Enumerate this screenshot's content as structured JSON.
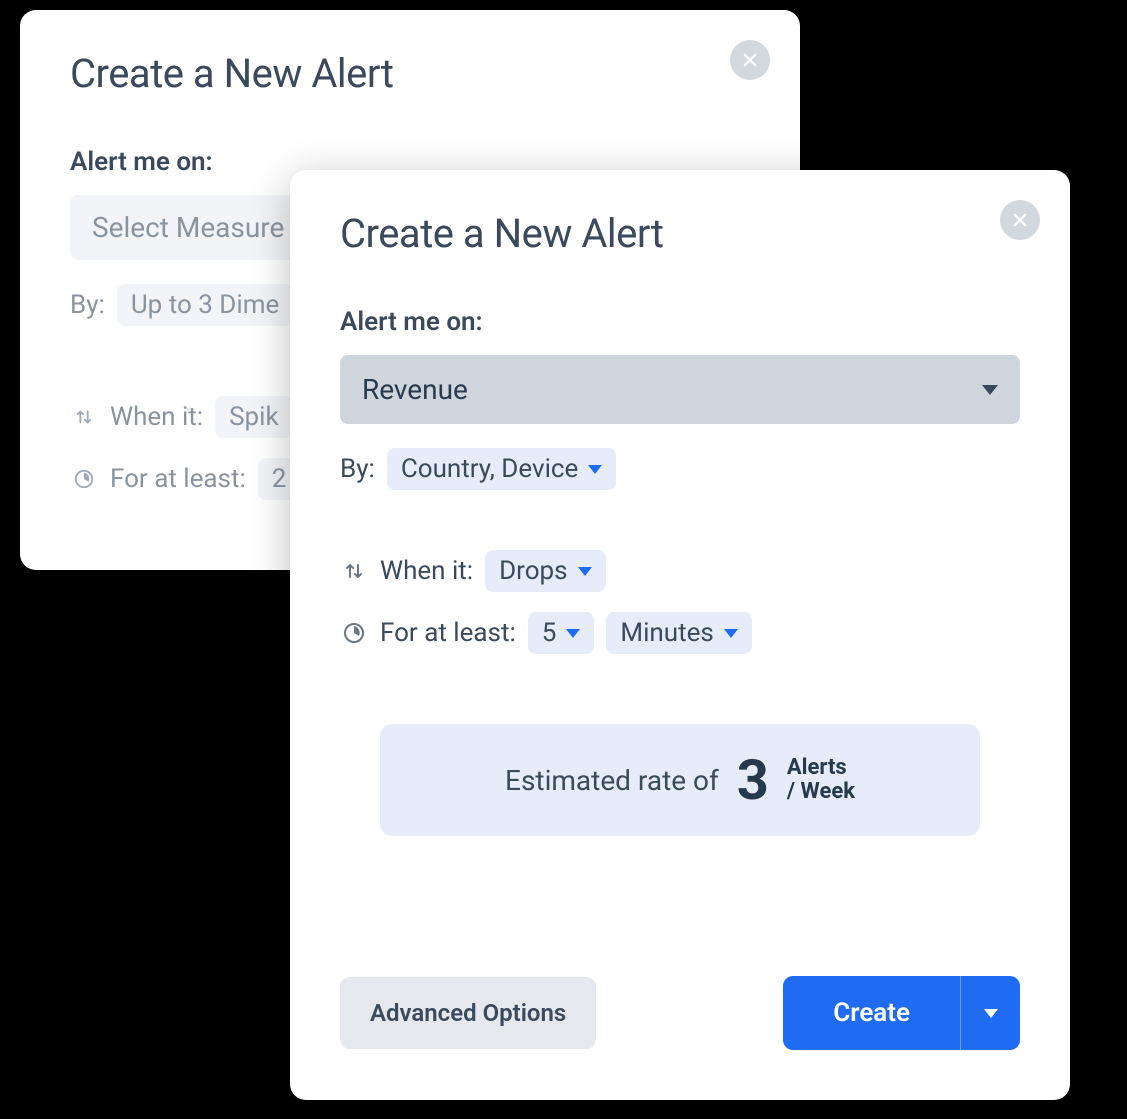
{
  "back_modal": {
    "title": "Create a New Alert",
    "alert_on_label": "Alert me on:",
    "measure_placeholder": "Select Measure",
    "by_label": "By:",
    "dimensions_placeholder": "Up to 3 Dime",
    "when_label": "When it:",
    "when_value": "Spik",
    "duration_label": "For at least:",
    "duration_value": "2"
  },
  "front_modal": {
    "title": "Create a New Alert",
    "alert_on_label": "Alert me on:",
    "measure_selected": "Revenue",
    "by_label": "By:",
    "dimensions_selected": "Country, Device",
    "when_label": "When it:",
    "when_value": "Drops",
    "duration_label": "For at least:",
    "duration_value": "5",
    "duration_unit": "Minutes",
    "estimate_prefix": "Estimated rate of",
    "estimate_number": "3",
    "estimate_line1": "Alerts",
    "estimate_line2": "/ Week",
    "advanced_label": "Advanced Options",
    "create_label": "Create"
  }
}
